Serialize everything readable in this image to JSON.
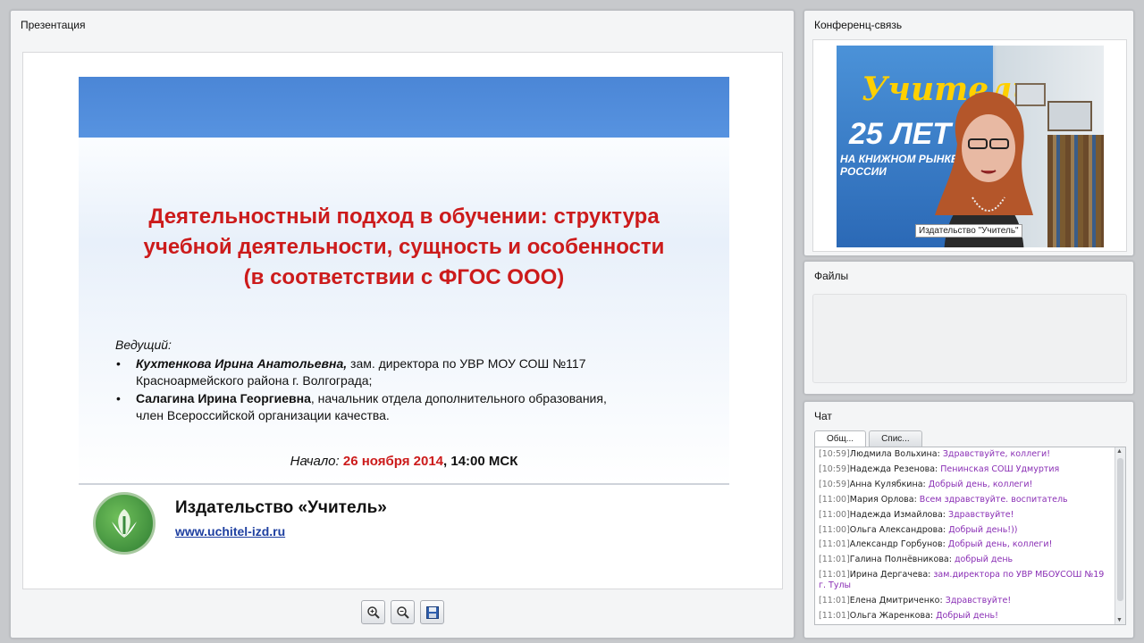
{
  "presentation": {
    "title": "Презентация",
    "slide": {
      "title_lines": [
        "Деятельностный подход в обучении: структура",
        "учебной деятельности, сущность и особенности",
        "(в соответствии с ФГОС ООО)"
      ],
      "leader_label": "Ведущий:",
      "presenters": [
        {
          "name": "Кухтенкова Ирина Анатольевна,",
          "desc_line1": " зам. директора по УВР МОУ СОШ №117",
          "desc_line2": "Красноармейского района г. Волгограда;"
        },
        {
          "name": "Салагина Ирина Георгиевна",
          "desc_line1": ", начальник отдела дополнительного образования,",
          "desc_line2": "член Всероссийской организации качества."
        }
      ],
      "start_label": "Начало:",
      "start_date": "26 ноября 2014",
      "start_time": ", 14:00 МСК",
      "publisher": "Издательство «Учитель»",
      "website": "www.uchitel-izd.ru"
    },
    "toolbar": {
      "zoom_in_icon": "zoom-in-icon",
      "zoom_out_icon": "zoom-out-icon",
      "save_icon": "floppy-disk-icon"
    }
  },
  "conference": {
    "title": "Конференц-связь",
    "video": {
      "brand_text": "Учитель",
      "years_text": "25 ЛЕТ",
      "banner_sub": "НА КНИЖНОМ РЫНКЕ РОССИИ",
      "caption": "Издательство \"Учитель\""
    }
  },
  "files": {
    "title": "Файлы"
  },
  "chat": {
    "title": "Чат",
    "tabs": [
      "Общ...",
      "Спис..."
    ],
    "messages": [
      {
        "time": "[10:59]",
        "name": "Людмила Вольхина:",
        "text": " Здравствуйте, коллеги!",
        "wrap": false
      },
      {
        "time": "[10:59]",
        "name": "Надежда Резенова:",
        "text": " Пенинская СОШ Удмуртия",
        "wrap": false
      },
      {
        "time": "[10:59]",
        "name": "Анна Кулябкина:",
        "text": " Добрый день, коллеги!",
        "wrap": false
      },
      {
        "time": "[11:00]",
        "name": "Мария Орлова:",
        "text": " Всем здравствуйте. воспитатель",
        "wrap": false
      },
      {
        "time": "[11:00]",
        "name": "Надежда Измайлова:",
        "text": " Здравствуйте!",
        "wrap": false
      },
      {
        "time": "[11:00]",
        "name": "Ольга Александрова:",
        "text": " Добрый день!))",
        "wrap": false
      },
      {
        "time": "[11:01]",
        "name": "Александр Горбунов:",
        "text": " Добрый день, коллеги!",
        "wrap": false
      },
      {
        "time": "[11:01]",
        "name": "Галина Полнёвникова:",
        "text": " добрый день",
        "wrap": false
      },
      {
        "time": "[11:01]",
        "name": "Ирина Дергачева:",
        "text": " зам.директора по УВР МБОУСОШ №19 г. Тулы",
        "wrap": true
      },
      {
        "time": "[11:01]",
        "name": "Елена Дмитриченко:",
        "text": " Здравствуйте!",
        "wrap": false
      },
      {
        "time": "[11:01]",
        "name": "Ольга Жаренкова:",
        "text": " Добрый день!",
        "wrap": false
      }
    ]
  },
  "colors": {
    "slide_title": "#cc1b1b",
    "chat_text": "#8a2fb5",
    "link": "#1e3fa0"
  }
}
